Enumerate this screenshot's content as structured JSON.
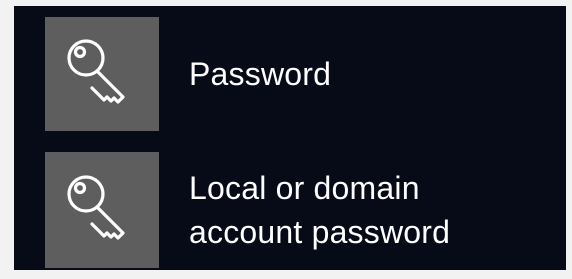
{
  "options": [
    {
      "icon": "key-icon",
      "label_lines": [
        "Password"
      ]
    },
    {
      "icon": "key-icon",
      "label_lines": [
        "Local or domain",
        "account password"
      ]
    }
  ],
  "colors": {
    "background": "#070b17",
    "tile": "#5e5e5e",
    "text": "#ffffff"
  }
}
